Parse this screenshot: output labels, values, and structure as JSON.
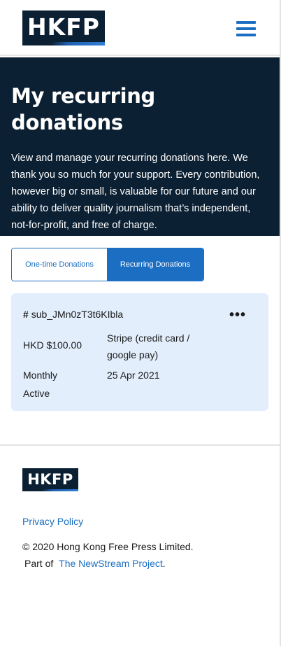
{
  "header": {
    "logo_text": "HKFP",
    "menu_icon": "hamburger-menu-icon"
  },
  "hero": {
    "title": "My recurring donations",
    "description": "View and manage your recurring donations here. We thank you so much for your support. Every contribution, however big or small, is valuable for our future and our ability to deliver quality journalism that’s independent, not-for-profit, and free of charge."
  },
  "tabs": [
    {
      "label": "One-time Donations",
      "active": false
    },
    {
      "label": "Recurring Donations",
      "active": true
    }
  ],
  "donation": {
    "id_prefix": "#",
    "id": "sub_JMn0zT3t6KIbla",
    "more_icon": "more-horizontal-icon",
    "more_label": "•••",
    "amount": "HKD $100.00",
    "payment_method": "Stripe (credit card / google pay)",
    "frequency": "Monthly",
    "status": "Active",
    "date": "25 Apr 2021"
  },
  "footer": {
    "logo_text": "HKFP",
    "privacy_link": "Privacy Policy",
    "copyright": "© 2020 Hong Kong Free Press Limited.",
    "part_of_prefix": "Part of",
    "project_link": "The NewStream Project",
    "part_of_suffix": "."
  },
  "colors": {
    "navy": "#0c2033",
    "accent_blue": "#1b6ec2",
    "card_bg": "#e2eefc"
  }
}
